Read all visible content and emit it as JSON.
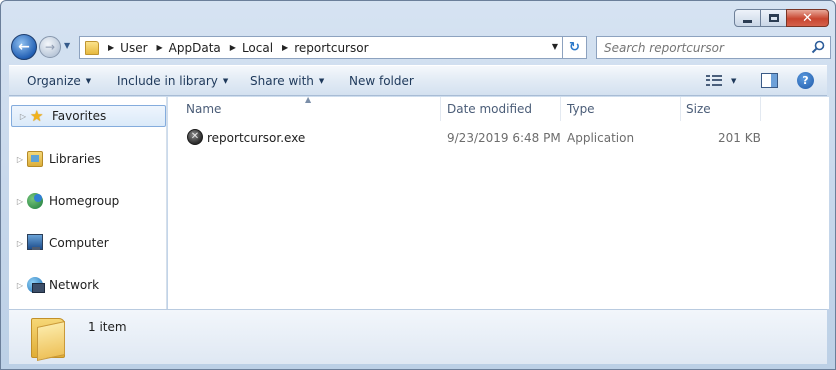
{
  "window": {
    "minimize_label": "Minimize",
    "maximize_label": "Maximize",
    "close_label": "✕"
  },
  "address_bar": {
    "breadcrumbs": [
      "User",
      "AppData",
      "Local",
      "reportcursor"
    ]
  },
  "search": {
    "placeholder": "Search reportcursor"
  },
  "toolbar": {
    "organize_label": "Organize",
    "include_in_library_label": "Include in library",
    "share_with_label": "Share with",
    "new_folder_label": "New folder",
    "help_label": "?"
  },
  "sidebar": {
    "items": [
      {
        "label": "Favorites",
        "icon": "star-icon"
      },
      {
        "label": "Libraries",
        "icon": "libraries-icon"
      },
      {
        "label": "Homegroup",
        "icon": "homegroup-icon"
      },
      {
        "label": "Computer",
        "icon": "computer-icon"
      },
      {
        "label": "Network",
        "icon": "network-icon"
      }
    ]
  },
  "file_list": {
    "columns": [
      "Name",
      "Date modified",
      "Type",
      "Size"
    ],
    "rows": [
      {
        "name": "reportcursor.exe",
        "date_modified": "9/23/2019 6:48 PM",
        "type": "Application",
        "size": "201 KB",
        "icon": "error-x-icon"
      }
    ]
  },
  "status_bar": {
    "item_count": "1 item"
  },
  "colors": {
    "accent": "#2a78c9",
    "selection_border": "#84acdd",
    "header_text": "#4b5d78"
  }
}
